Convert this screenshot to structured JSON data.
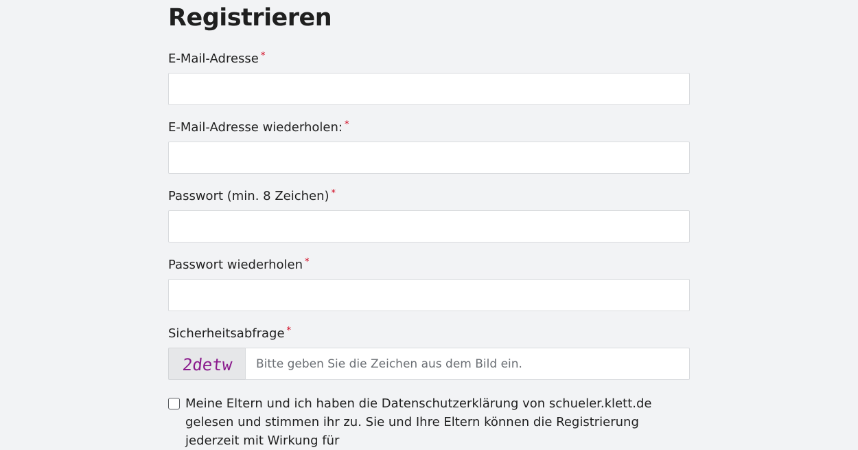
{
  "form": {
    "title": "Registrieren",
    "required_marker": "*",
    "fields": [
      {
        "label": "E-Mail-Adresse",
        "value": ""
      },
      {
        "label": "E-Mail-Adresse wiederholen:",
        "value": ""
      },
      {
        "label": "Passwort (min. 8 Zeichen)",
        "value": ""
      },
      {
        "label": "Passwort wiederholen",
        "value": ""
      }
    ],
    "captcha": {
      "label": "Sicherheitsabfrage",
      "image_text": "2detw",
      "placeholder": "Bitte geben Sie die Zeichen aus dem Bild ein.",
      "image_color": "#8a1a8c"
    },
    "consent": {
      "checked": false,
      "text": "Meine Eltern und ich haben die Datenschutzerklärung von schueler.klett.de gelesen und stimmen ihr zu. Sie und Ihre Eltern können die Registrierung jederzeit mit Wirkung für"
    }
  },
  "colors": {
    "background": "#f2f3f5",
    "required": "#d0021b",
    "input_border": "#d9dbde"
  }
}
